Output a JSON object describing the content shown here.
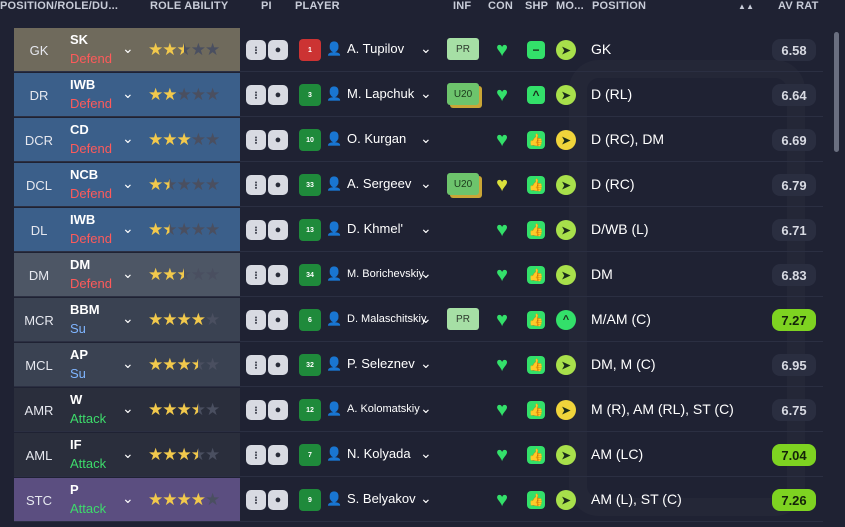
{
  "header": {
    "position_role": "POSITION/ROLE/DU...",
    "role_ability": "ROLE ABILITY",
    "pi": "PI",
    "player": "PLAYER",
    "inf": "INF",
    "con": "CON",
    "shp": "SHP",
    "mo": "MO...",
    "position": "POSITION",
    "sort_icon": "▲▲",
    "av_rat": "AV RAT"
  },
  "colors": {
    "gk_bg": "#6f6a5c",
    "defender_bg": "#3b5f8a",
    "dm_bg": "#4d5665",
    "midfield_bg": "#3a4252",
    "attack_bg": "#2a2e3c",
    "stc_bg": "#5b4e80",
    "defend_text": "#ff5a5a",
    "support_text": "#7fb5ff",
    "attack_text": "#3ddc6b",
    "high_rating": "#7ed321"
  },
  "rows": [
    {
      "pos": "GK",
      "role": "SK",
      "duty": "Defend",
      "stars": [
        1,
        1,
        0.5,
        0,
        0
      ],
      "shirt": "1",
      "name": "A. Tupilov",
      "inf": "PR",
      "con": "green",
      "shp": "−",
      "mov": "➤",
      "position": "GK",
      "rating": "6.58",
      "high": false
    },
    {
      "pos": "DR",
      "role": "IWB",
      "duty": "Defend",
      "stars": [
        1,
        1,
        0,
        0,
        0
      ],
      "shirt": "3",
      "name": "M. Lapchuk",
      "inf": "U20",
      "con": "green",
      "shp": "^",
      "mov": "➤",
      "position": "D (RL)",
      "rating": "6.64",
      "high": false
    },
    {
      "pos": "DCR",
      "role": "CD",
      "duty": "Defend",
      "stars": [
        1,
        1,
        1,
        0,
        0
      ],
      "shirt": "10",
      "name": "O. Kurgan",
      "inf": "",
      "con": "green",
      "shp": "👍",
      "mov": "➤",
      "position": "D (RC), DM",
      "rating": "6.69",
      "high": false
    },
    {
      "pos": "DCL",
      "role": "NCB",
      "duty": "Defend",
      "stars": [
        1,
        0.5,
        0,
        0,
        0
      ],
      "shirt": "33",
      "name": "A. Sergeev",
      "inf": "U20",
      "con": "yellow",
      "shp": "👍",
      "mov": "➤",
      "position": "D (RC)",
      "rating": "6.79",
      "high": false
    },
    {
      "pos": "DL",
      "role": "IWB",
      "duty": "Defend",
      "stars": [
        1,
        0.5,
        0,
        0,
        0
      ],
      "shirt": "13",
      "name": "D. Khmel'",
      "inf": "",
      "con": "green",
      "shp": "👍",
      "mov": "➤",
      "position": "D/WB (L)",
      "rating": "6.71",
      "high": false
    },
    {
      "pos": "DM",
      "role": "DM",
      "duty": "Defend",
      "stars": [
        1,
        1,
        0.5,
        0,
        0
      ],
      "shirt": "34",
      "name": "M. Borichevskiy",
      "inf": "",
      "con": "green",
      "shp": "👍",
      "mov": "➤",
      "position": "DM",
      "rating": "6.83",
      "high": false
    },
    {
      "pos": "MCR",
      "role": "BBM",
      "duty": "Su",
      "stars": [
        1,
        1,
        1,
        1,
        0
      ],
      "shirt": "6",
      "name": "D. Malaschitskiy",
      "inf": "PR",
      "con": "green",
      "shp": "👍",
      "mov": "^",
      "position": "M/AM (C)",
      "rating": "7.27",
      "high": true
    },
    {
      "pos": "MCL",
      "role": "AP",
      "duty": "Su",
      "stars": [
        1,
        1,
        1,
        0.5,
        0
      ],
      "shirt": "32",
      "name": "P. Seleznev",
      "inf": "",
      "con": "green",
      "shp": "👍",
      "mov": "➤",
      "position": "DM, M (C)",
      "rating": "6.95",
      "high": false
    },
    {
      "pos": "AMR",
      "role": "W",
      "duty": "Attack",
      "stars": [
        1,
        1,
        1,
        0.5,
        0
      ],
      "shirt": "12",
      "name": "A. Kolomatskiy",
      "inf": "",
      "con": "green",
      "shp": "👍",
      "mov": "➤",
      "position": "M (R), AM (RL), ST (C)",
      "rating": "6.75",
      "high": false
    },
    {
      "pos": "AML",
      "role": "IF",
      "duty": "Attack",
      "stars": [
        1,
        1,
        1,
        0.5,
        0
      ],
      "shirt": "7",
      "name": "N. Kolyada",
      "inf": "",
      "con": "green",
      "shp": "👍",
      "mov": "➤",
      "position": "AM (LC)",
      "rating": "7.04",
      "high": true
    },
    {
      "pos": "STC",
      "role": "P",
      "duty": "Attack",
      "stars": [
        1,
        1,
        1,
        1,
        0
      ],
      "shirt": "9",
      "name": "S. Belyakov",
      "inf": "",
      "con": "green",
      "shp": "👍",
      "mov": "➤",
      "position": "AM (L), ST (C)",
      "rating": "7.26",
      "high": true
    }
  ]
}
